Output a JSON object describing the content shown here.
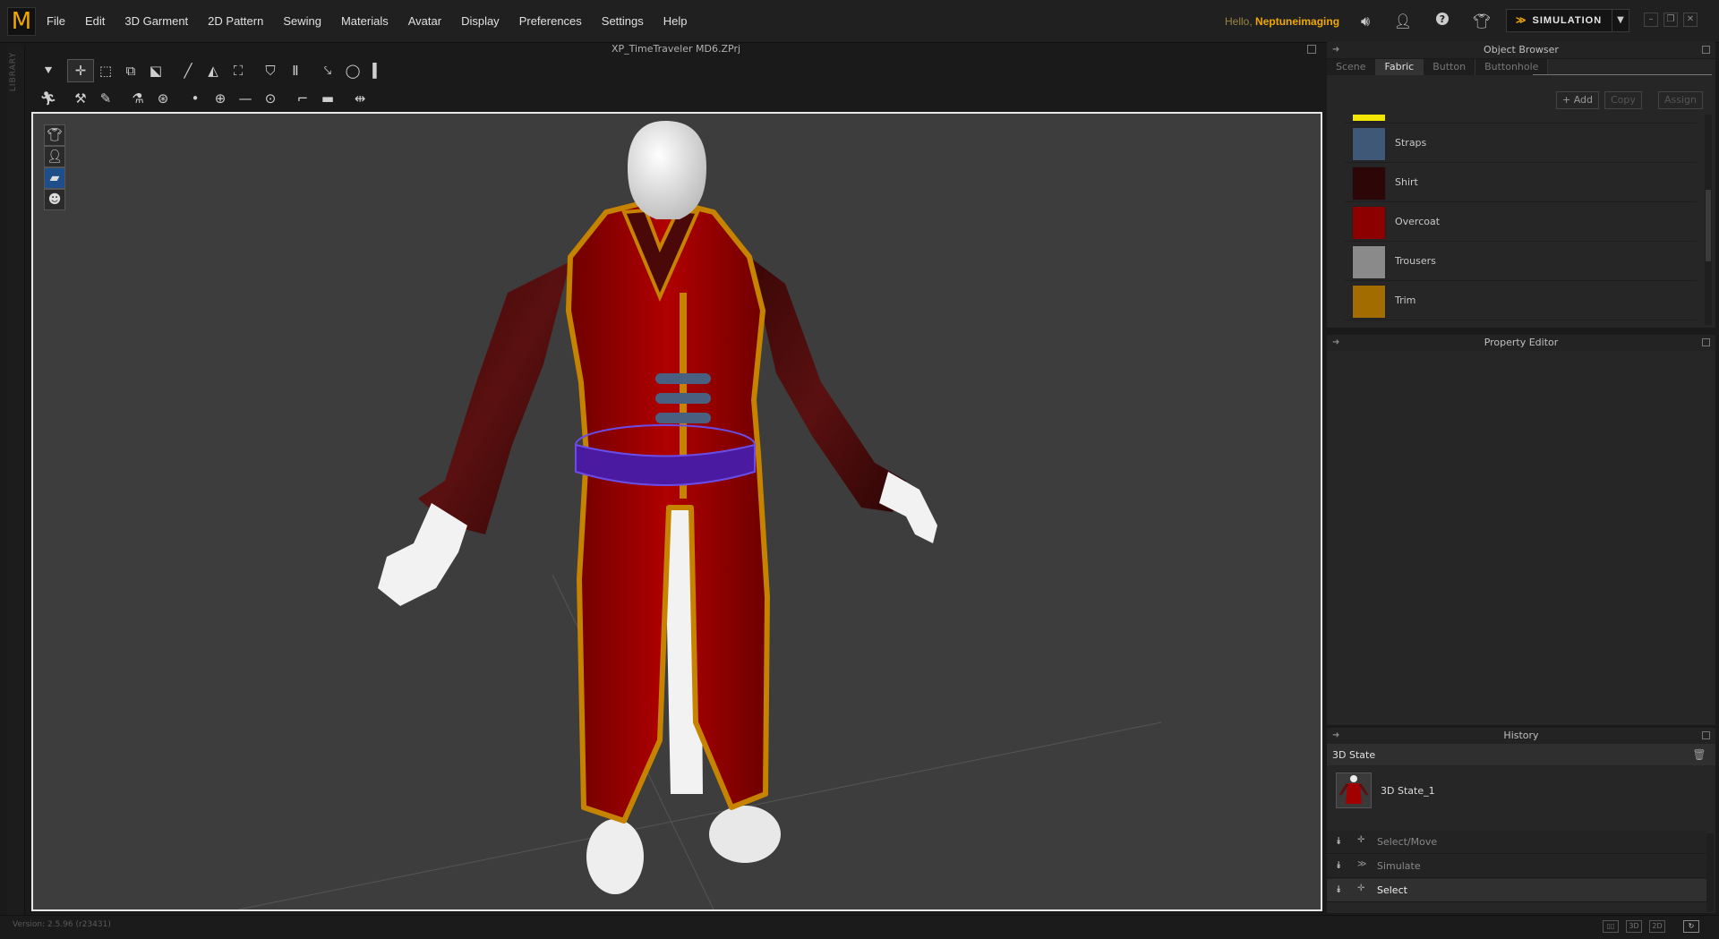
{
  "app": {
    "logo_letter": "M",
    "menus": [
      "File",
      "Edit",
      "3D Garment",
      "2D Pattern",
      "Sewing",
      "Materials",
      "Avatar",
      "Display",
      "Preferences",
      "Settings",
      "Help"
    ],
    "greeting_prefix": "Hello,",
    "username": "Neptuneimaging",
    "simulation_label": "SIMULATION",
    "accent_color": "#f0a800"
  },
  "viewport": {
    "title": "XP_TimeTraveler MD6.ZPrj",
    "side_library_label": "LIBRARY",
    "toolbar_row1": [
      "avatar-down-icon",
      "select-move-icon",
      "transform-icon",
      "transform-alt-icon",
      "edit-pattern-icon",
      "pen-icon",
      "fold-icon",
      "arrange-icon",
      "garment-icon",
      "trousers-icon",
      "tack-icon",
      "lasso-icon",
      "ruler-icon"
    ],
    "toolbar_row2": [
      "pose-icon",
      "pin-icon",
      "brush-icon",
      "fitting-icon",
      "button-icon",
      "point-icon",
      "circle-icon",
      "line-icon",
      "measure-icon",
      "flat-icon",
      "layer-icon",
      "snap-icon"
    ],
    "side_tools": [
      "garment-view-icon",
      "avatar-view-icon",
      "fabric-view-icon",
      "skin-view-icon"
    ]
  },
  "object_browser": {
    "title": "Object Browser",
    "tabs": [
      "Scene",
      "Fabric",
      "Button",
      "Buttonhole"
    ],
    "active_tab": "Fabric",
    "buttons": {
      "add": "+ Add",
      "copy": "Copy",
      "assign": "Assign"
    },
    "fabrics": [
      {
        "name": "Straps",
        "color": "#3f5878"
      },
      {
        "name": "Shirt",
        "color": "#2d0707"
      },
      {
        "name": "Overcoat",
        "color": "#8c0000"
      },
      {
        "name": "Trousers",
        "color": "#8a8a8a"
      },
      {
        "name": "Trim",
        "color": "#a26c00"
      }
    ],
    "partial_top_swatch_color": "#f2e600"
  },
  "property_editor": {
    "title": "Property Editor"
  },
  "history": {
    "title": "History",
    "state_header": "3D State",
    "state_name": "3D State_1",
    "actions": [
      {
        "label": "Select/Move",
        "icon": "select-move-icon",
        "selected": false
      },
      {
        "label": "Simulate",
        "icon": "simulate-icon",
        "selected": false
      },
      {
        "label": "Select",
        "icon": "select-icon",
        "selected": true
      }
    ]
  },
  "status": {
    "version": "Version: 2.5.96   (r23431)"
  }
}
